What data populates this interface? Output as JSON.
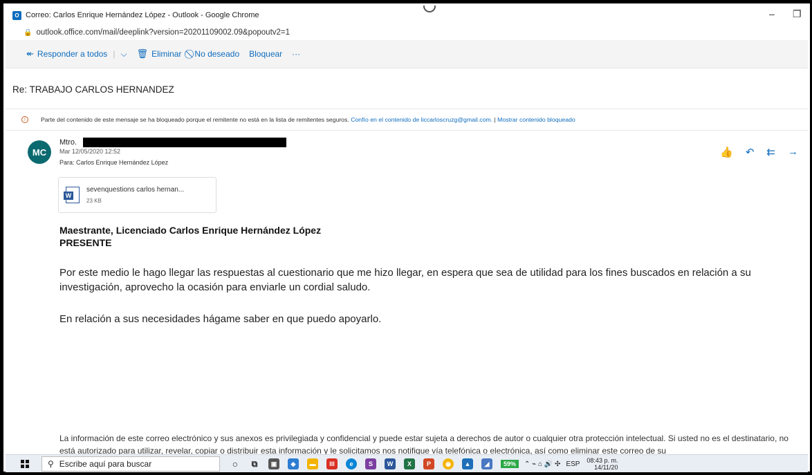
{
  "window": {
    "title": "Correo: Carlos Enrique Hernández López - Outlook - Google Chrome",
    "url": "outlook.office.com/mail/deeplink?version=20201109002.09&popoutv2=1"
  },
  "toolbar": {
    "reply_all": "Responder a todos",
    "delete": "Eliminar",
    "junk": "No deseado",
    "block": "Bloquear",
    "more": "···"
  },
  "email": {
    "subject": "Re: TRABAJO CARLOS HERNANDEZ",
    "warning_text": "Parte del contenido de este mensaje se ha bloqueado porque el remitente no está en la lista de remitentes seguros.",
    "trust_link": "Confío en el contenido de liccarloscruzg@gmail.com.",
    "show_blocked": "Mostrar contenido bloqueado",
    "avatar_initials": "MC",
    "sender_prefix": "Mtro.",
    "date": "Mar 12/05/2020 12:52",
    "to": "Para:  Carlos Enrique Hernández López",
    "attachment_name": "sevenquestions carlos hernan...",
    "attachment_size": "23 KB",
    "greeting_line1": "Maestrante, Licenciado Carlos Enrique Hernández López",
    "greeting_line2": "PRESENTE",
    "paragraph1": "Por este medio le hago llegar las respuestas al cuestionario que me hizo llegar, en espera que sea de utilidad para los fines buscados en relación a su investigación, aprovecho la ocasión para enviarle un cordial saludo.",
    "paragraph2": "En relación a sus necesidades hágame saber en que puedo apoyarlo.",
    "footer": "La información de este correo electrónico y sus anexos es privilegiada y confidencial y puede estar sujeta a derechos de autor o cualquier otra protección intelectual. Si usted no es el destinatario, no está autorizado para utilizar, revelar, copiar o distribuir esta información y le solicitamos nos notifique vía telefónica o electrónica, así como eliminar este correo de su"
  },
  "taskbar": {
    "search_placeholder": "Escribe aquí para buscar",
    "battery": "59%",
    "language": "ESP",
    "time": "08:43 p. m.",
    "date": "14/11/20"
  },
  "colors": {
    "accent": "#0f6cbd",
    "avatar": "#0b6a6f",
    "warning": "#c85c20"
  }
}
